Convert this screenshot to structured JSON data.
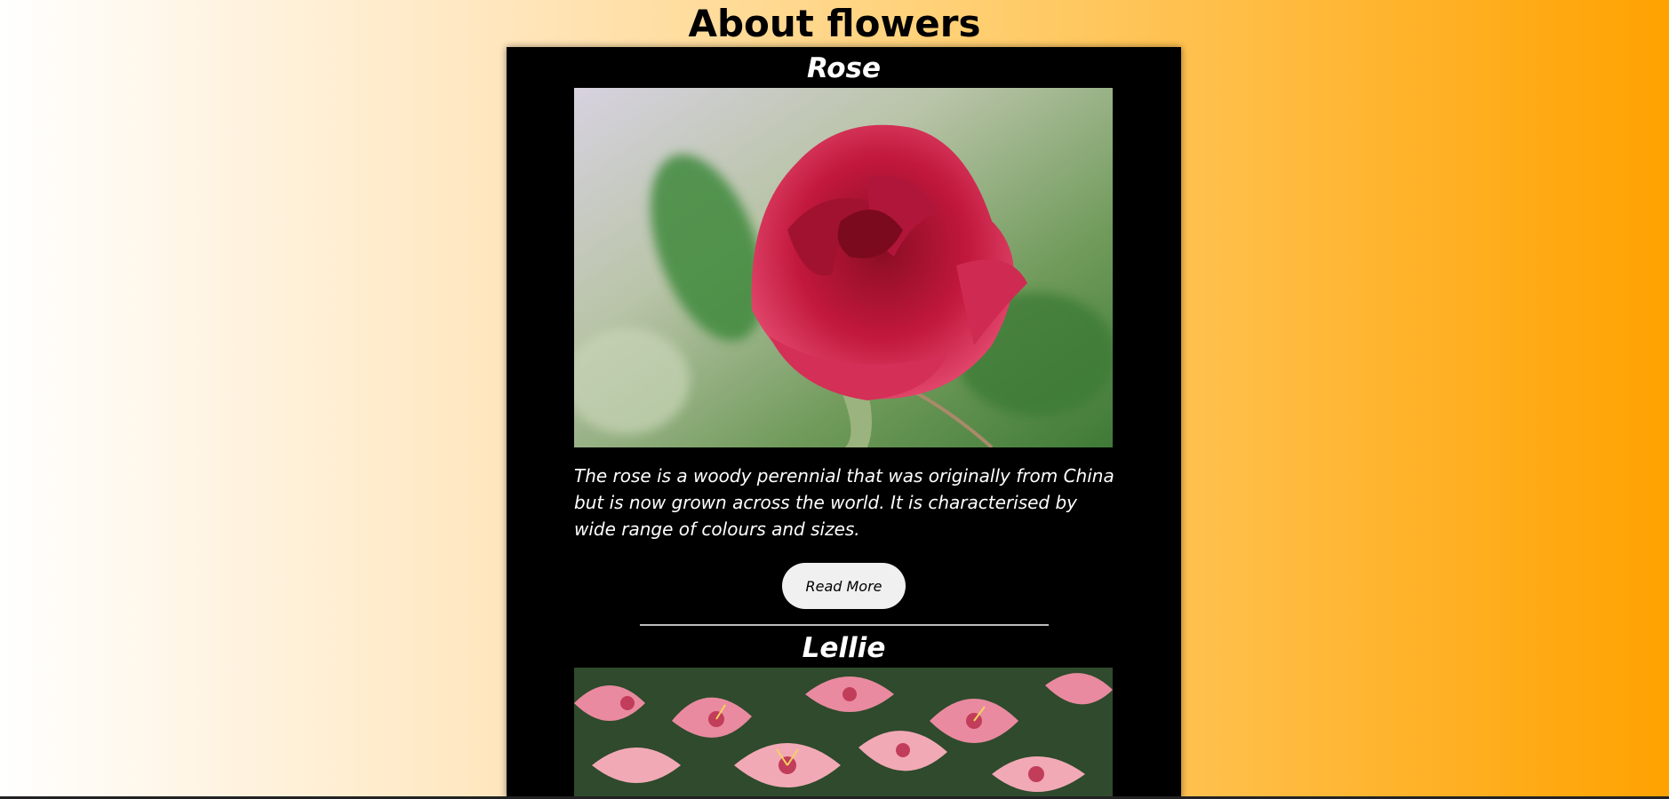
{
  "page": {
    "title": "About flowers"
  },
  "flowers": [
    {
      "name": "Rose",
      "description": "The rose is a woody perennial that was originally from China but is now grown across the world. It is characterised by wide range of colours and sizes.",
      "read_more_label": "Read More"
    },
    {
      "name": "Lellie"
    }
  ],
  "colors": {
    "card_background": "#000000",
    "gradient_start": "#ffffff",
    "gradient_end": "#ffa200",
    "button_background": "#f0f0f0"
  }
}
